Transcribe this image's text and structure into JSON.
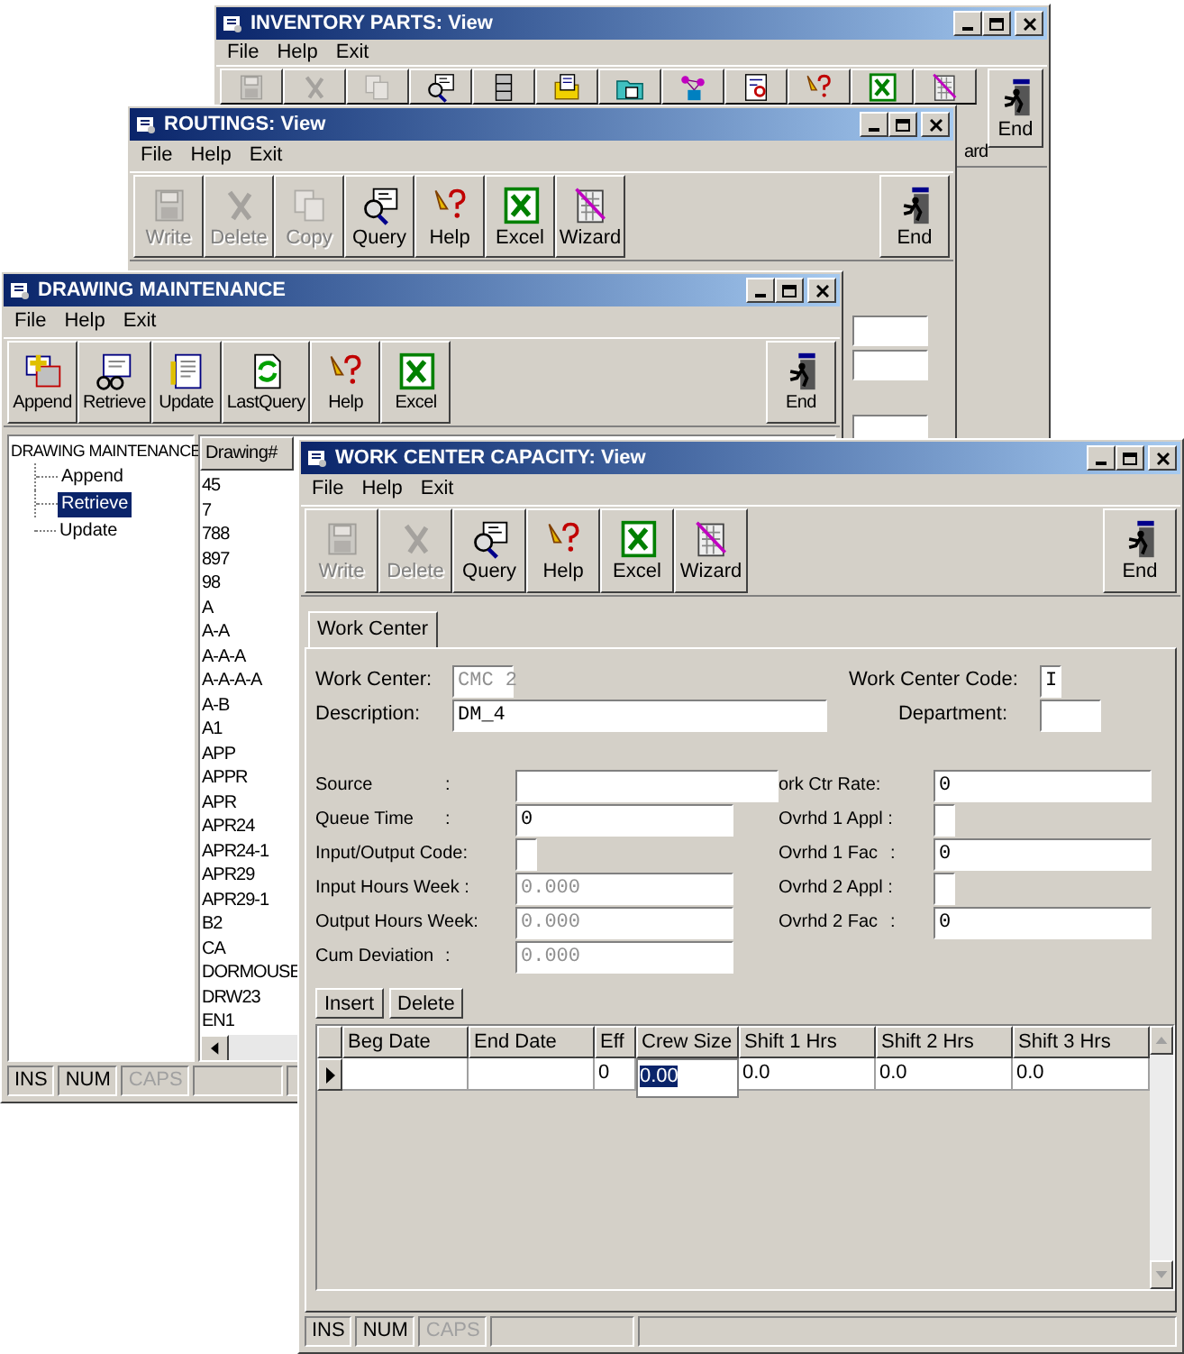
{
  "inventory_window": {
    "title": "INVENTORY PARTS: View",
    "menu": [
      "File",
      "Help",
      "Exit"
    ],
    "toolbar": [
      {
        "kind": "save",
        "disabled": true
      },
      {
        "kind": "delete",
        "disabled": true
      },
      {
        "kind": "copy",
        "disabled": true
      },
      {
        "kind": "query",
        "disabled": false
      },
      {
        "kind": "cabinet",
        "disabled": false
      },
      {
        "kind": "folder_edit",
        "disabled": false
      },
      {
        "kind": "folder",
        "disabled": false
      },
      {
        "kind": "network",
        "disabled": false
      },
      {
        "kind": "report",
        "disabled": false
      },
      {
        "kind": "help",
        "disabled": false
      },
      {
        "kind": "excel",
        "disabled": false
      },
      {
        "kind": "wizard",
        "label": "ard",
        "disabled": false
      },
      {
        "kind": "end",
        "label": "End",
        "disabled": false
      }
    ]
  },
  "routings_window": {
    "title": "ROUTINGS: View",
    "menu": [
      "File",
      "Help",
      "Exit"
    ],
    "toolbar": [
      {
        "kind": "save",
        "label": "Write",
        "disabled": true
      },
      {
        "kind": "delete",
        "label": "Delete",
        "disabled": true
      },
      {
        "kind": "copy",
        "label": "Copy",
        "disabled": true
      },
      {
        "kind": "query",
        "label": "Query",
        "disabled": false
      },
      {
        "kind": "help",
        "label": "Help",
        "disabled": false
      },
      {
        "kind": "excel",
        "label": "Excel",
        "disabled": false
      },
      {
        "kind": "wizard",
        "label": "Wizard",
        "disabled": false
      },
      {
        "kind": "end",
        "label": "End",
        "disabled": false
      }
    ]
  },
  "drawing_window": {
    "title": "DRAWING MAINTENANCE",
    "menu": [
      "File",
      "Help",
      "Exit"
    ],
    "toolbar": [
      {
        "kind": "append",
        "label": "Append",
        "disabled": false
      },
      {
        "kind": "retrieve",
        "label": "Retrieve",
        "disabled": false
      },
      {
        "kind": "update",
        "label": "Update",
        "disabled": false
      },
      {
        "kind": "lastquery",
        "label": "LastQuery",
        "disabled": false
      },
      {
        "kind": "help",
        "label": "Help",
        "disabled": false
      },
      {
        "kind": "excel",
        "label": "Excel",
        "disabled": false
      },
      {
        "kind": "end",
        "label": "End",
        "disabled": false
      }
    ],
    "tree": {
      "label": "DRAWING MAINTENANCE",
      "selected": false,
      "children": [
        {
          "label": "Append",
          "selected": false
        },
        {
          "label": "Retrieve",
          "selected": true
        },
        {
          "label": "Update",
          "selected": false
        }
      ]
    },
    "list": {
      "header": "Drawing#",
      "items": [
        "45",
        "7",
        "788",
        "897",
        "98",
        "A",
        "A-A",
        "A-A-A",
        "A-A-A-A",
        "A-B",
        "A1",
        "APP",
        "APPR",
        "APR",
        "APR24",
        "APR24-1",
        "APR29",
        "APR29-1",
        "B2",
        "CA",
        "DORMOUSE",
        "DRW23",
        "EN1"
      ]
    },
    "status_bar": [
      {
        "label": "INS",
        "disabled": false
      },
      {
        "label": "NUM",
        "disabled": false
      },
      {
        "label": "CAPS",
        "disabled": true
      }
    ]
  },
  "work_center_window": {
    "title": "WORK CENTER CAPACITY: View",
    "menu": [
      "File",
      "Help",
      "Exit"
    ],
    "toolbar": [
      {
        "kind": "save",
        "label": "Write",
        "disabled": true
      },
      {
        "kind": "delete",
        "label": "Delete",
        "disabled": true
      },
      {
        "kind": "query",
        "label": "Query",
        "disabled": false
      },
      {
        "kind": "help",
        "label": "Help",
        "disabled": false
      },
      {
        "kind": "excel",
        "label": "Excel",
        "disabled": false
      },
      {
        "kind": "wizard",
        "label": "Wizard",
        "disabled": false
      },
      {
        "kind": "end",
        "label": "End",
        "disabled": false
      }
    ],
    "tabs": [
      {
        "label": "Work Center",
        "selected": true
      }
    ],
    "header_fields": [
      {
        "label": "Work Center:",
        "value": "CMC 2",
        "disabled": true
      },
      {
        "label": "Description:",
        "value": "DM_4",
        "disabled": false
      }
    ],
    "right_header_fields": [
      {
        "label": "Work Center Code:",
        "value": "I"
      },
      {
        "label": "Department:"
      }
    ],
    "left_fields": [
      {
        "label": "Source",
        "colon": ":",
        "kind": "wide"
      },
      {
        "label": "Queue Time",
        "colon": ":",
        "kind": "text",
        "value": "0",
        "disabled": false
      },
      {
        "label": "Input/Output Code:",
        "kind": "check"
      },
      {
        "label": "Input Hours Week :",
        "kind": "text",
        "value": "0.000",
        "disabled": true
      },
      {
        "label": "Output Hours Week:",
        "kind": "text",
        "value": "0.000",
        "disabled": true
      },
      {
        "label": "Cum Deviation",
        "colon": ":",
        "kind": "text",
        "value": "0.000",
        "disabled": true
      }
    ],
    "right_fields": [
      {
        "label": "ork Ctr Rate:",
        "kind": "text",
        "value": "0"
      },
      {
        "label": "Ovrhd 1 Appl :",
        "kind": "check"
      },
      {
        "label": "Ovrhd 1 Fac",
        "colon": ":",
        "kind": "text",
        "value": "0"
      },
      {
        "label": "Ovrhd 2 Appl :",
        "kind": "check"
      },
      {
        "label": "Ovrhd 2 Fac",
        "colon": ":",
        "kind": "text",
        "value": "0"
      }
    ],
    "grid_buttons": [
      "Insert",
      "Delete"
    ],
    "grid": {
      "columns": [
        "Beg Date",
        "End Date",
        "Eff",
        "Crew Size",
        "Shift 1 Hrs",
        "Shift 2 Hrs",
        "Shift 3 Hrs"
      ],
      "rows": [
        {
          "current": true,
          "cells": [
            {
              "kind": "empty"
            },
            {
              "kind": "empty"
            },
            {
              "kind": "text",
              "text": "0"
            },
            {
              "kind": "edit",
              "text": "0.00"
            },
            {
              "kind": "text",
              "text": "0.0"
            },
            {
              "kind": "text",
              "text": "0.0"
            },
            {
              "kind": "text",
              "text": "0.0"
            }
          ]
        }
      ]
    },
    "status_bar": [
      {
        "label": "INS",
        "disabled": false
      },
      {
        "label": "NUM",
        "disabled": false
      },
      {
        "label": "CAPS",
        "disabled": true
      }
    ]
  }
}
